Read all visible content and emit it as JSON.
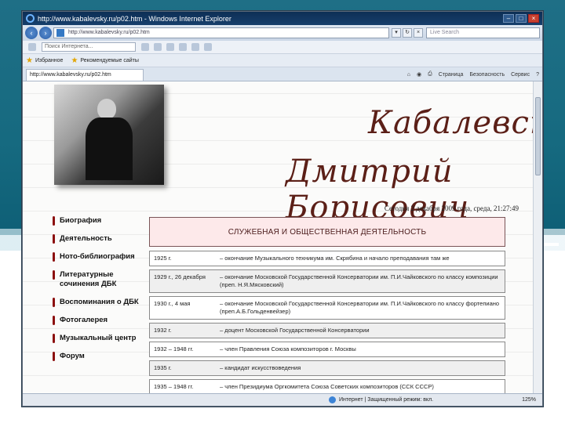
{
  "window": {
    "title": "http://www.kabalevsky.ru/p02.htm - Windows Internet Explorer"
  },
  "address_bar": {
    "url": "http://www.kabalevsky.ru/p02.htm",
    "search_placeholder": "Live Search"
  },
  "menu_bar": {
    "search_placeholder": "Поиск Интернета..."
  },
  "favorites_bar": {
    "favorites_label": "Избранное",
    "suggested_label": "Рекомендуемые сайты"
  },
  "tab_bar": {
    "active_tab": "http://www.kabalevsky.ru/p02.htm",
    "commands": [
      "Страница",
      "Безопасность",
      "Сервис"
    ]
  },
  "page": {
    "name_line1": "Кабалевский",
    "name_line2": "Дмитрий Борисович",
    "date_line": "Сегодня 2 декабря 2009 года, среда, 21:27:49",
    "heading": "СЛУЖЕБНАЯ И ОБЩЕСТВЕННАЯ ДЕЯТЕЛЬНОСТЬ",
    "left_menu": [
      {
        "label": "Биография"
      },
      {
        "label": "Деятельность"
      },
      {
        "label": "Ното-библиография"
      },
      {
        "label": "Литературные сочинения ДБК"
      },
      {
        "label": "Воспоминания о ДБК"
      },
      {
        "label": "Фотогалерея"
      },
      {
        "label": "Музыкальный центр"
      },
      {
        "label": "Форум"
      }
    ],
    "table": [
      {
        "date": "1925 г.",
        "text": "– окончание Музыкального техникума им. Скрябина и начало преподавания там же"
      },
      {
        "date": "1929 г., 26 декабря",
        "text": "– окончание Московской Государственной Консерватории им. П.И.Чайковского по классу композиции (преп. Н.Я.Мясковский)"
      },
      {
        "date": "1930 г., 4 мая",
        "text": "– окончание Московской Государственной Консерватории им. П.И.Чайковского по классу фортепиано (преп.А.Б.Гольденвейзер)"
      },
      {
        "date": "1932 г.",
        "text": "– доцент Московской Государственной Консерватории"
      },
      {
        "date": "1932 – 1948 гг.",
        "text": "– член Правления Союза композиторов г. Москвы"
      },
      {
        "date": "1935 г.",
        "text": "– кандидат искусствоведения"
      },
      {
        "date": "1935 – 1948 гг.",
        "text": "– член Президиума Оргкомитета Союза Советских композиторов (ССК СССР)"
      }
    ]
  },
  "status_bar": {
    "zone": "Интернет | Защищенный режим: вкл.",
    "zoom": "125%"
  }
}
